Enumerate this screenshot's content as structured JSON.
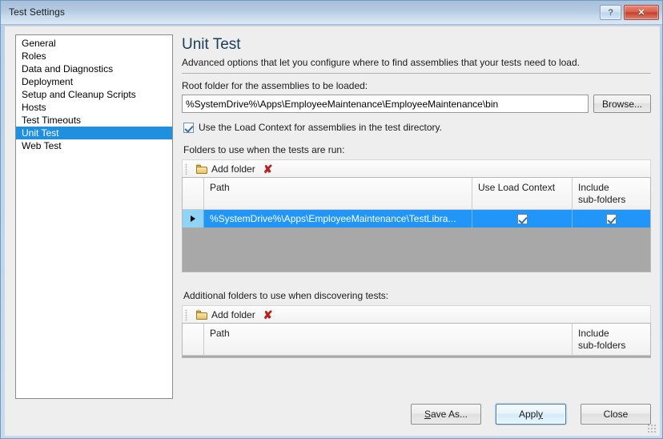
{
  "window": {
    "title": "Test Settings",
    "help_button": "?",
    "close_button": "✕"
  },
  "sidebar": {
    "items": [
      {
        "label": "General",
        "selected": false
      },
      {
        "label": "Roles",
        "selected": false
      },
      {
        "label": "Data and Diagnostics",
        "selected": false
      },
      {
        "label": "Deployment",
        "selected": false
      },
      {
        "label": "Setup and Cleanup Scripts",
        "selected": false
      },
      {
        "label": "Hosts",
        "selected": false
      },
      {
        "label": "Test Timeouts",
        "selected": false
      },
      {
        "label": "Unit Test",
        "selected": true
      },
      {
        "label": "Web Test",
        "selected": false
      }
    ],
    "selection_color": "#1f8fe0"
  },
  "page": {
    "title": "Unit Test",
    "subtitle": "Advanced options that let you configure where to find assemblies that your tests need to load."
  },
  "root_folder": {
    "label": "Root folder for the assemblies to be loaded:",
    "value": "%SystemDrive%\\Apps\\EmployeeMaintenance\\EmployeeMaintenance\\bin",
    "placeholder": "",
    "browse_label": "Browse..."
  },
  "load_context": {
    "label": "Use the Load Context for assemblies in the test directory.",
    "checked": true
  },
  "folders_run": {
    "label": "Folders to use when the tests are run:",
    "toolbar": {
      "add_folder_label": "Add folder",
      "delete_label": "✘"
    },
    "columns": [
      "",
      "Path",
      "Use Load Context",
      "Include\nsub-folders"
    ],
    "column_include_line1": "Include",
    "column_include_line2": "sub-folders",
    "column_path": "Path",
    "column_use_load_context": "Use Load Context",
    "rows": [
      {
        "selected": true,
        "row_marker": "▶",
        "path": "%SystemDrive%\\Apps\\EmployeeMaintenance\\TestLibra...",
        "use_load_context": true,
        "include_subfolders": true
      }
    ]
  },
  "folders_discover": {
    "label": "Additional folders to use when discovering tests:",
    "toolbar": {
      "add_folder_label": "Add folder",
      "delete_label": "✘"
    },
    "column_path": "Path",
    "column_include_line1": "Include",
    "column_include_line2": "sub-folders",
    "rows": []
  },
  "buttons": {
    "save_as": "Save As...",
    "apply": "Apply",
    "close": "Close"
  },
  "colors": {
    "selection_blue": "#2196f8",
    "row_header_blue": "#8fd4f6",
    "grid_empty_gray": "#a8a8a8",
    "title_text": "#1c1c1c",
    "heading": "#1b3d57"
  }
}
